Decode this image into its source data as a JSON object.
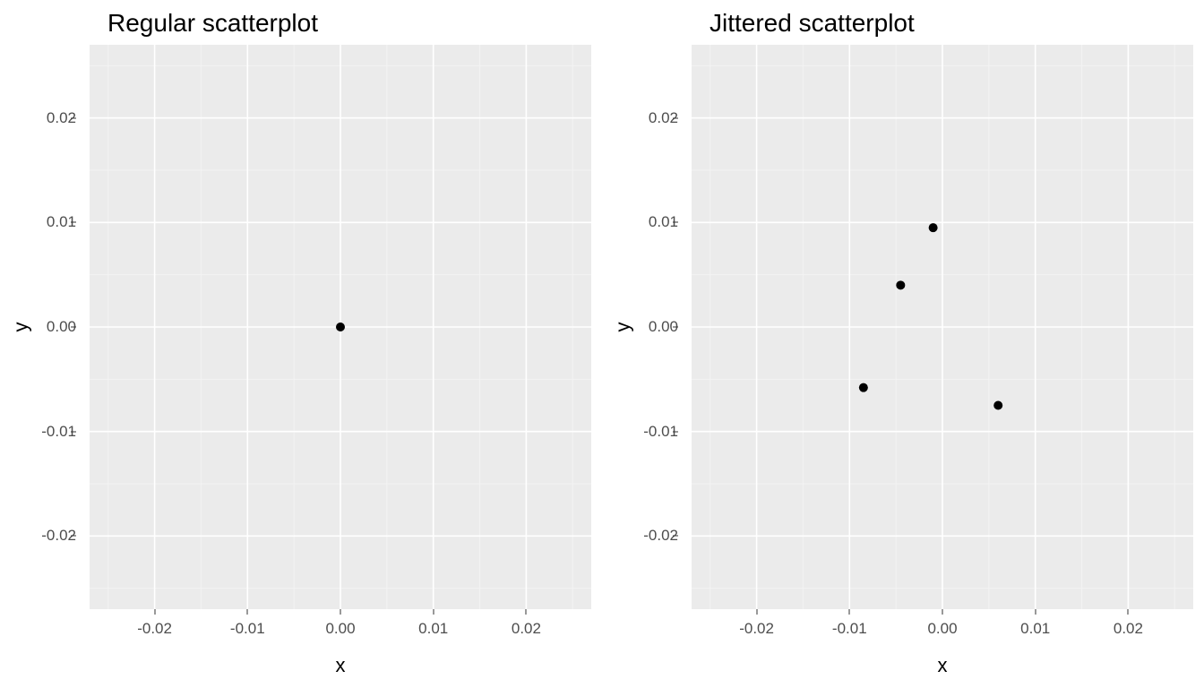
{
  "chart_data": [
    {
      "type": "scatter",
      "title": "Regular scatterplot",
      "xlabel": "x",
      "ylabel": "y",
      "xlim": [
        -0.027,
        0.027
      ],
      "ylim": [
        -0.027,
        0.027
      ],
      "x_ticks": [
        -0.02,
        -0.01,
        0.0,
        0.01,
        0.02
      ],
      "y_ticks": [
        -0.02,
        -0.01,
        0.0,
        0.01,
        0.02
      ],
      "x_tick_labels": [
        "-0.02",
        "-0.01",
        "0.00",
        "0.01",
        "0.02"
      ],
      "y_tick_labels": [
        "-0.02",
        "-0.01",
        "0.00",
        "0.01",
        "0.02"
      ],
      "points": [
        {
          "x": 0.0,
          "y": 0.0
        }
      ]
    },
    {
      "type": "scatter",
      "title": "Jittered scatterplot",
      "xlabel": "x",
      "ylabel": "y",
      "xlim": [
        -0.027,
        0.027
      ],
      "ylim": [
        -0.027,
        0.027
      ],
      "x_ticks": [
        -0.02,
        -0.01,
        0.0,
        0.01,
        0.02
      ],
      "y_ticks": [
        -0.02,
        -0.01,
        0.0,
        0.01,
        0.02
      ],
      "x_tick_labels": [
        "-0.02",
        "-0.01",
        "0.00",
        "0.01",
        "0.02"
      ],
      "y_tick_labels": [
        "-0.02",
        "-0.01",
        "0.00",
        "0.01",
        "0.02"
      ],
      "points": [
        {
          "x": -0.001,
          "y": 0.0095
        },
        {
          "x": -0.0045,
          "y": 0.004
        },
        {
          "x": -0.0085,
          "y": -0.0058
        },
        {
          "x": 0.006,
          "y": -0.0075
        }
      ]
    }
  ]
}
